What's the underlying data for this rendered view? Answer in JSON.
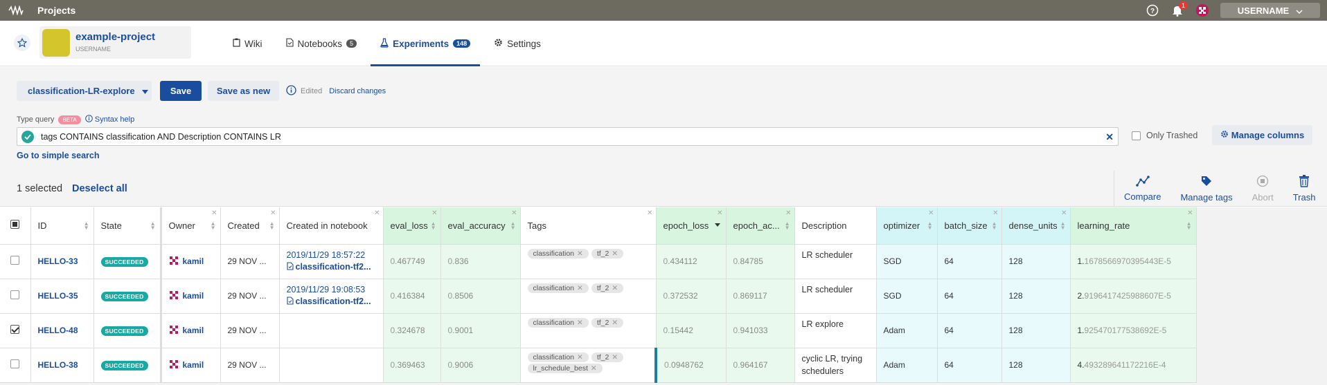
{
  "topbar": {
    "title": "Projects",
    "notifications_count": "1",
    "username": "USERNAME"
  },
  "project": {
    "name": "example-project",
    "owner": "USERNAME"
  },
  "tabs": [
    {
      "label": "Wiki",
      "icon": "clipboard-icon"
    },
    {
      "label": "Notebooks",
      "count": "5",
      "icon": "notebook-icon"
    },
    {
      "label": "Experiments",
      "count": "148",
      "icon": "flask-icon",
      "active": true
    },
    {
      "label": "Settings",
      "icon": "gear-icon"
    }
  ],
  "view": {
    "name": "classification-LR-explore",
    "save_label": "Save",
    "save_as_label": "Save as new",
    "edited_label": "Edited",
    "discard_label": "Discard changes"
  },
  "query": {
    "label": "Type query",
    "beta": "BETA",
    "syntax_help": "Syntax help",
    "text": "tags CONTAINS classification AND Description CONTAINS LR",
    "only_trashed": "Only Trashed",
    "manage_columns": "Manage columns",
    "go_simple": "Go to simple search"
  },
  "selection": {
    "count_text": "1 selected",
    "deselect": "Deselect all",
    "actions": [
      "Compare",
      "Manage tags",
      "Abort",
      "Trash"
    ]
  },
  "table": {
    "columns": [
      "ID",
      "State",
      "Owner",
      "Created",
      "Created in notebook",
      "eval_loss",
      "eval_accuracy",
      "Tags",
      "epoch_loss",
      "epoch_ac...",
      "Description",
      "optimizer",
      "batch_size",
      "dense_units",
      "learning_rate"
    ],
    "rows": [
      {
        "id": "HELLO-33",
        "state": "SUCCEEDED",
        "owner": "kamil",
        "created": "29 NOV ...",
        "nb_date": "2019/11/29 18:57:22",
        "nb_file": "classification-tf2...",
        "eval_loss_a": "0.",
        "eval_loss_b": "467749",
        "eval_acc_a": "0.",
        "eval_acc_b": "836",
        "tags": [
          "classification",
          "tf_2"
        ],
        "epoch_loss_a": "0.",
        "epoch_loss_b": "434112",
        "epoch_acc_a": "0.",
        "epoch_acc_b": "84785",
        "desc": "LR scheduler",
        "optimizer": "SGD",
        "batch_size": "64",
        "dense_units": "128",
        "lr_a": "1.",
        "lr_b": "1678566970395443E-5",
        "checked": false
      },
      {
        "id": "HELLO-35",
        "state": "SUCCEEDED",
        "owner": "kamil",
        "created": "29 NOV ...",
        "nb_date": "2019/11/29 19:08:53",
        "nb_file": "classification-tf2...",
        "eval_loss_a": "0.",
        "eval_loss_b": "416384",
        "eval_acc_a": "0.",
        "eval_acc_b": "8506",
        "tags": [
          "classification",
          "tf_2"
        ],
        "epoch_loss_a": "0.",
        "epoch_loss_b": "372532",
        "epoch_acc_a": "0.",
        "epoch_acc_b": "869117",
        "desc": "LR scheduler",
        "optimizer": "SGD",
        "batch_size": "64",
        "dense_units": "128",
        "lr_a": "2.",
        "lr_b": "9196417425988607E-5",
        "checked": false
      },
      {
        "id": "HELLO-48",
        "state": "SUCCEEDED",
        "owner": "kamil",
        "created": "29 NOV ...",
        "nb_date": "",
        "nb_file": "",
        "eval_loss_a": "0.",
        "eval_loss_b": "324678",
        "eval_acc_a": "0.",
        "eval_acc_b": "9001",
        "tags": [
          "classification",
          "tf_2"
        ],
        "epoch_loss_a": "0.",
        "epoch_loss_b": "15442",
        "epoch_acc_a": "0.",
        "epoch_acc_b": "941033",
        "desc": "LR explore",
        "optimizer": "Adam",
        "batch_size": "64",
        "dense_units": "128",
        "lr_a": "1.",
        "lr_b": "925470177538692E-5",
        "checked": true
      },
      {
        "id": "HELLO-38",
        "state": "SUCCEEDED",
        "owner": "kamil",
        "created": "29 NOV ...",
        "nb_date": "",
        "nb_file": "",
        "eval_loss_a": "0.",
        "eval_loss_b": "369463",
        "eval_acc_a": "0.",
        "eval_acc_b": "9006",
        "tags": [
          "classification",
          "tf_2",
          "lr_schedule_best"
        ],
        "epoch_loss_a": "0.",
        "epoch_loss_b": "0948762",
        "epoch_acc_a": "0.",
        "epoch_acc_b": "964167",
        "desc": "cyclic LR, trying schedulers",
        "optimizer": "Adam",
        "batch_size": "64",
        "dense_units": "128",
        "lr_a": "4.",
        "lr_b": "493289641172216E-4",
        "checked": false
      }
    ]
  },
  "colors": {
    "accent": "#1a4d9e",
    "topbar": "#6d6a60",
    "succeeded": "#17a9a3",
    "metric_green": "#d8f5df",
    "param_cyan": "#d4f5f7"
  }
}
